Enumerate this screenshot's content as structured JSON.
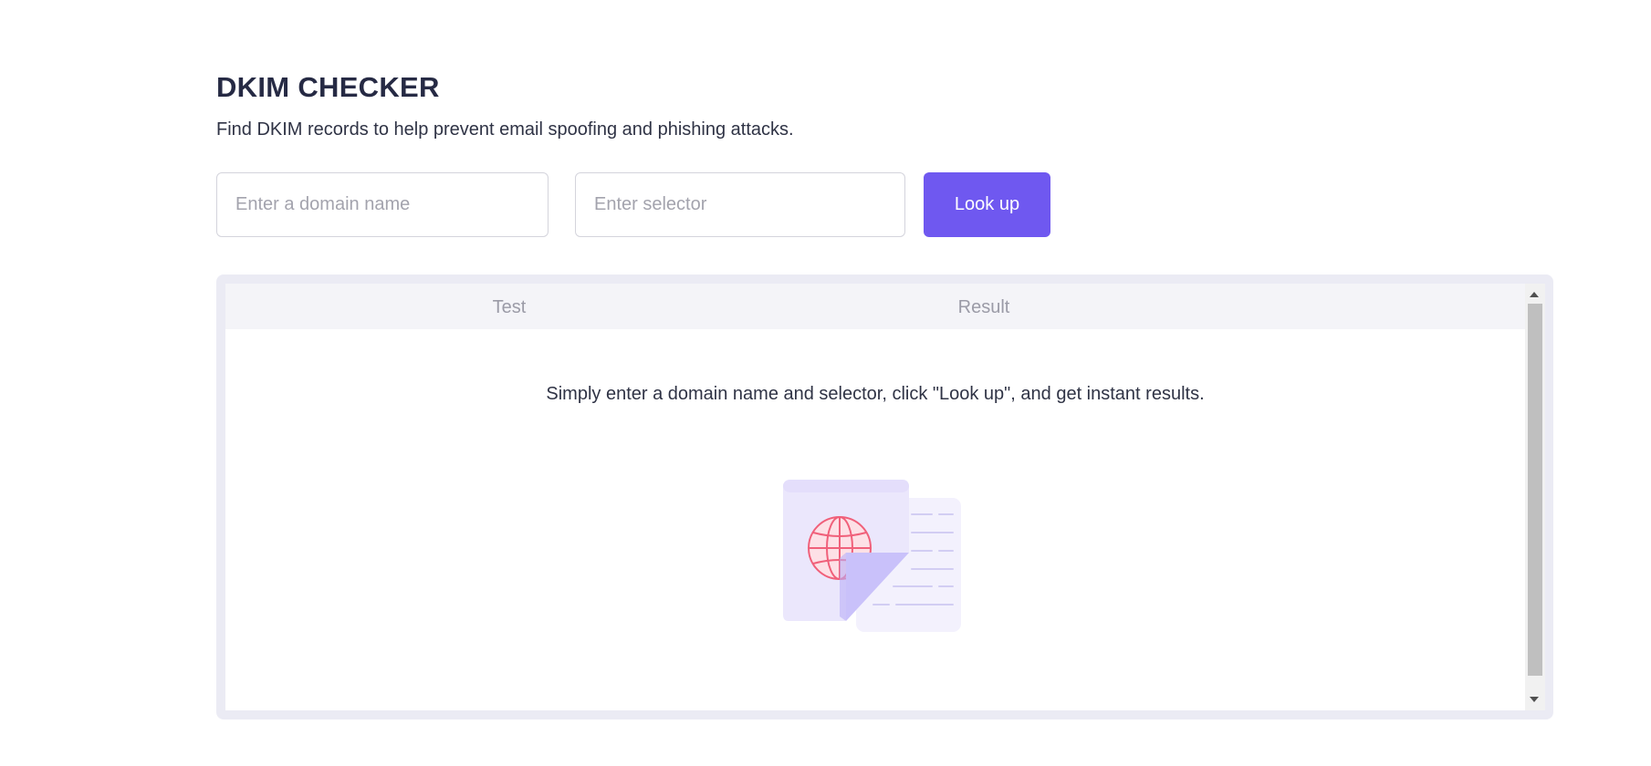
{
  "header": {
    "title": "DKIM CHECKER",
    "subtitle": "Find DKIM records to help prevent email spoofing and phishing attacks."
  },
  "form": {
    "domain_placeholder": "Enter a domain name",
    "domain_value": "",
    "selector_placeholder": "Enter selector",
    "selector_value": "",
    "lookup_label": "Look up"
  },
  "results": {
    "columns": [
      "Test",
      "Result"
    ],
    "empty_message": "Simply enter a domain name and selector, click \"Look up\", and get instant results.",
    "illustration_icon": "document-globe-icon"
  },
  "colors": {
    "accent": "#6f58f0",
    "title": "#262a44",
    "panel_bg": "#ebebf4",
    "header_bg": "#f4f4f8",
    "globe": "#f0607a",
    "doc_fill": "#f3f1fd",
    "fold": "#c9c1fa"
  }
}
